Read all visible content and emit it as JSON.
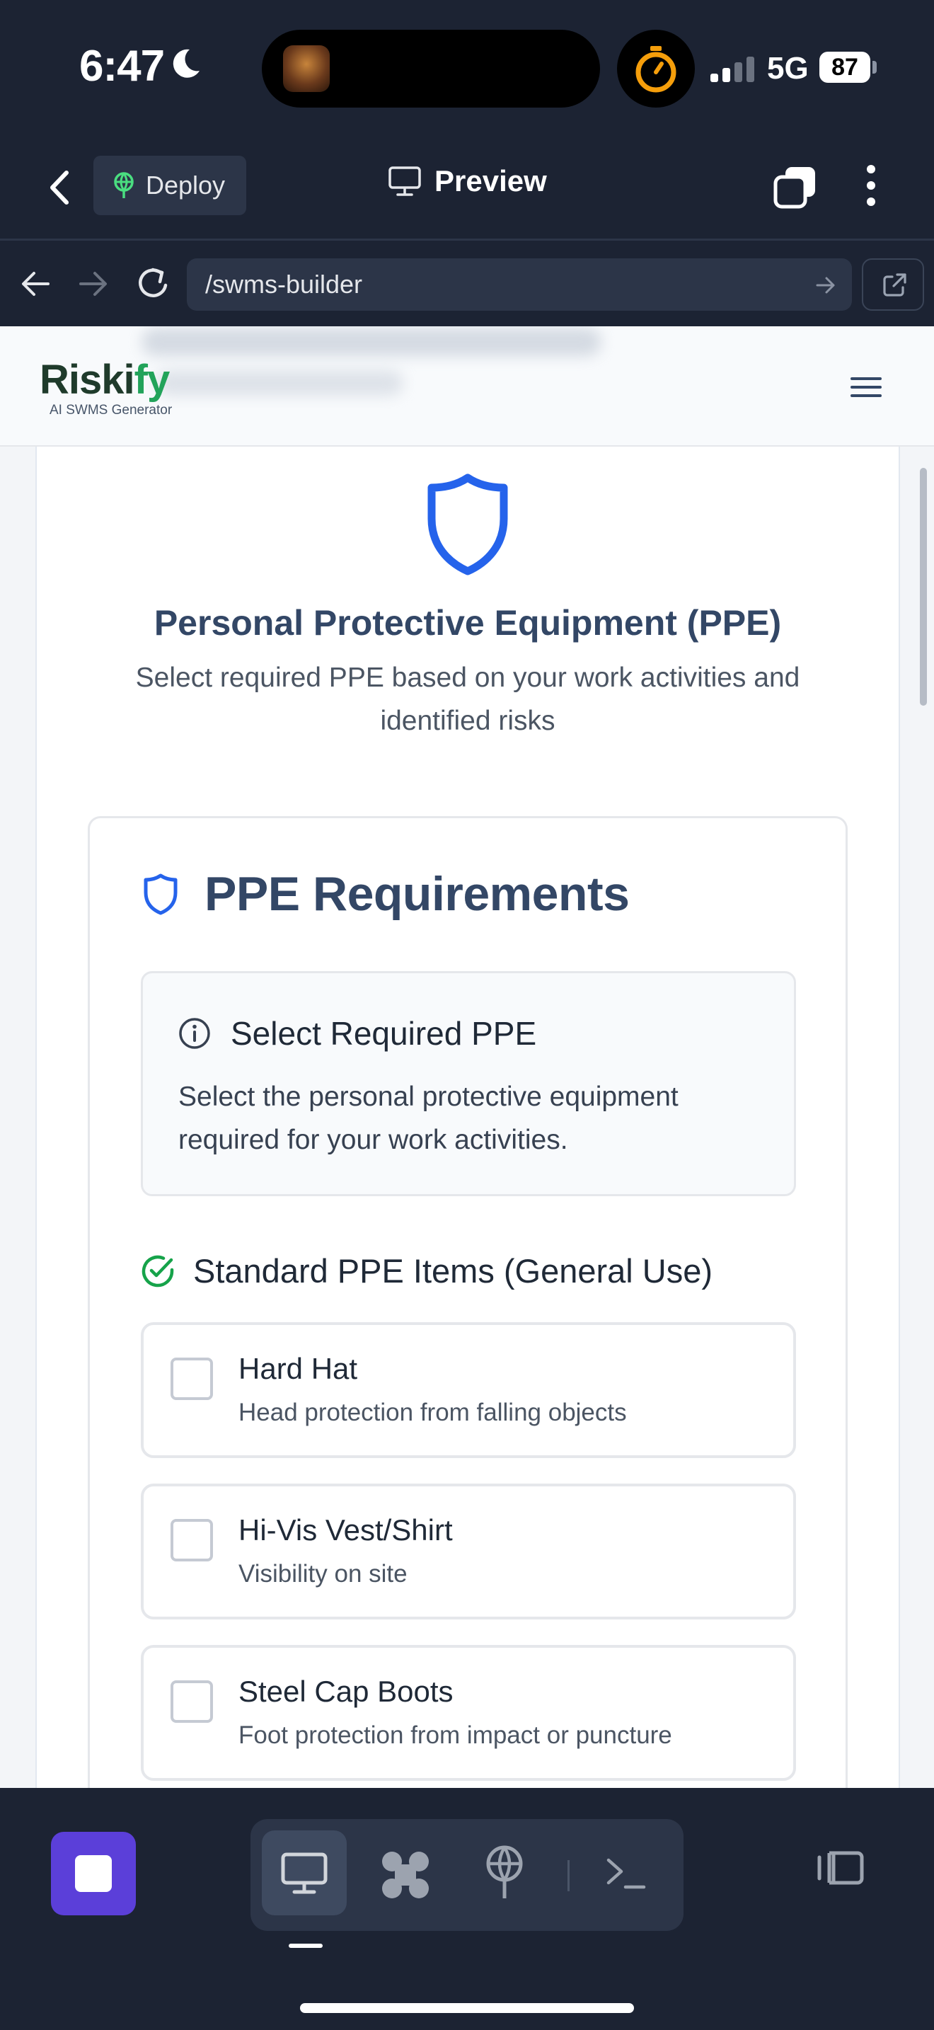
{
  "status_bar": {
    "time": "6:47",
    "network": "5G",
    "battery": "87",
    "moon_icon": "moon-icon",
    "timer_icon": "stopwatch-icon"
  },
  "app_bar": {
    "deploy_label": "Deploy",
    "preview_label": "Preview"
  },
  "browser": {
    "url": "/swms-builder"
  },
  "site": {
    "logo_text_pre": "Riski",
    "logo_text_accent": "fy",
    "logo_subtitle": "AI SWMS Generator"
  },
  "page": {
    "title": "Personal Protective Equipment (PPE)",
    "subtitle": "Select required PPE based on your work activities and identified risks",
    "card_title": "PPE Requirements",
    "info_title": "Select Required PPE",
    "info_text": "Select the personal protective equipment required for your work activities.",
    "standard_heading": "Standard PPE Items (General Use)",
    "items": [
      {
        "name": "Hard Hat",
        "desc": "Head protection from falling objects",
        "checked": false
      },
      {
        "name": "Hi-Vis Vest/Shirt",
        "desc": "Visibility on site",
        "checked": false
      },
      {
        "name": "Steel Cap Boots",
        "desc": "Foot protection from impact or puncture",
        "checked": false
      }
    ]
  },
  "colors": {
    "chrome_bg": "#1c2333",
    "accent_blue": "#2563eb",
    "heading": "#334766",
    "success_green": "#16a34a",
    "stop_purple": "#5b3fd9"
  }
}
